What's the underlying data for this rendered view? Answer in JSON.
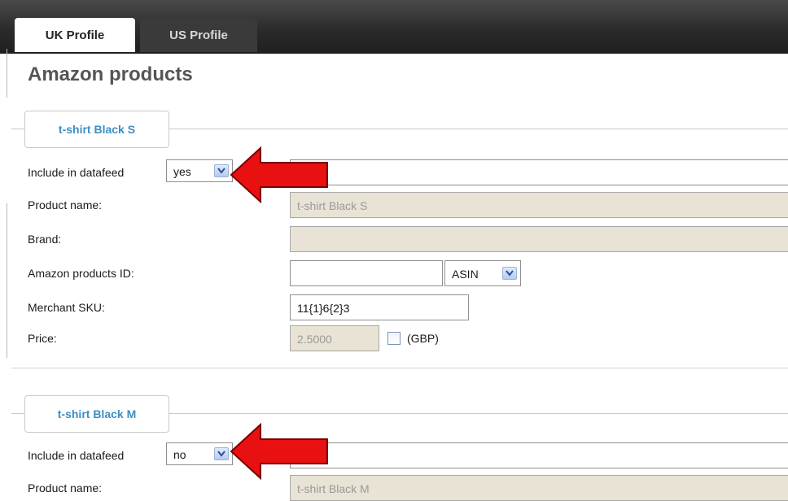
{
  "tabs": [
    {
      "label": "UK Profile",
      "active": true
    },
    {
      "label": "US Profile",
      "active": false
    }
  ],
  "page_title": "Amazon products",
  "products": [
    {
      "legend": "t-shirt Black S",
      "include_label": "Include in datafeed",
      "include_value": "yes",
      "product_name_label": "Product name:",
      "product_name_value": "t-shirt Black S",
      "brand_label": "Brand:",
      "brand_value": "",
      "amazon_id_label": "Amazon products ID:",
      "amazon_id_value": "",
      "amazon_id_type": "ASIN",
      "sku_label": "Merchant SKU:",
      "sku_value": "11{1}6{2}3",
      "price_label": "Price:",
      "price_value": "2.5000",
      "price_unit": "(GBP)"
    },
    {
      "legend": "t-shirt Black M",
      "include_label": "Include in datafeed",
      "include_value": "no",
      "product_name_label": "Product name:",
      "product_name_value": "t-shirt Black M"
    }
  ],
  "icons": {
    "dropdown": "chevron-down-icon",
    "annotation": "red-arrow-left-icon"
  },
  "colors": {
    "legend_text": "#3e8ec2",
    "disabled_field": "#e8e3d5",
    "arrow": "#e81010",
    "topbar": "#2b2b2b"
  }
}
